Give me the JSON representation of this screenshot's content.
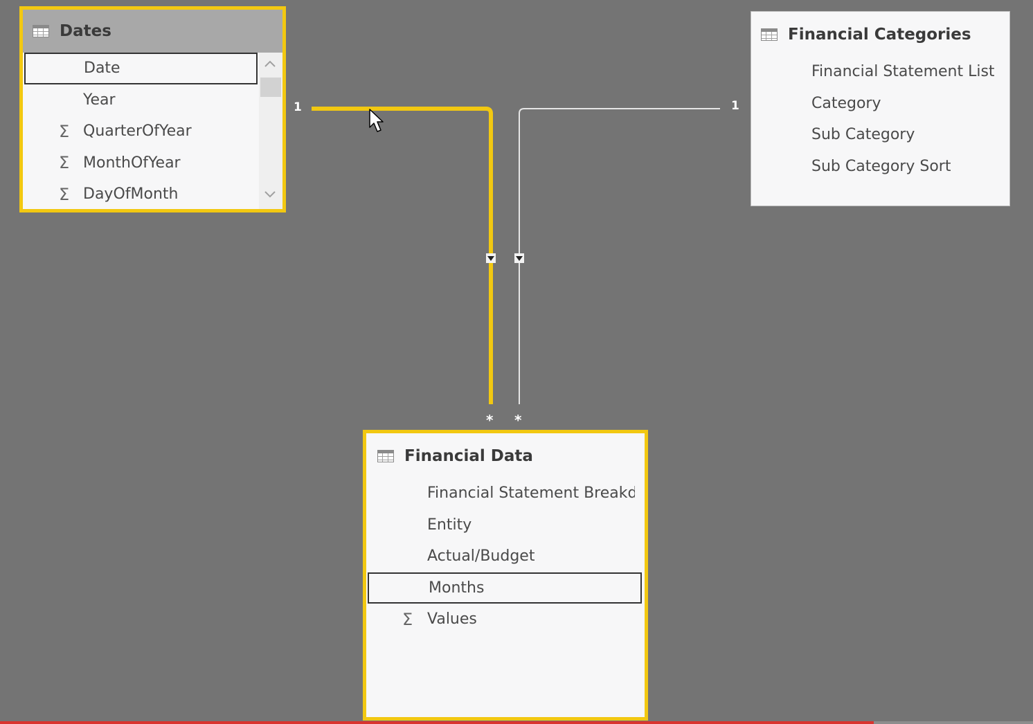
{
  "colors": {
    "canvas_bg": "#747474",
    "selected_accent": "#f2c811",
    "relationship_inactive": "#e6e6e6",
    "progress_fill": "#d9342f"
  },
  "tables": {
    "dates": {
      "title": "Dates",
      "icon": "table-icon",
      "selected": true,
      "fields": [
        {
          "label": "Date",
          "aggregate": false,
          "highlighted": true
        },
        {
          "label": "Year",
          "aggregate": false,
          "highlighted": false
        },
        {
          "label": "QuarterOfYear",
          "aggregate": true,
          "highlighted": false
        },
        {
          "label": "MonthOfYear",
          "aggregate": true,
          "highlighted": false
        },
        {
          "label": "DayOfMonth",
          "aggregate": true,
          "highlighted": false
        }
      ],
      "scroll_up_glyph": "⌃",
      "scroll_down_glyph": "⌄"
    },
    "financial_categories": {
      "title": "Financial Categories",
      "icon": "table-icon",
      "selected": false,
      "fields": [
        {
          "label": "Financial Statement List"
        },
        {
          "label": "Category"
        },
        {
          "label": "Sub Category"
        },
        {
          "label": "Sub Category Sort"
        }
      ]
    },
    "financial_data": {
      "title": "Financial Data",
      "icon": "table-icon",
      "selected": true,
      "fields": [
        {
          "label": "Financial Statement Breakd",
          "aggregate": false,
          "highlighted": false
        },
        {
          "label": "Entity",
          "aggregate": false,
          "highlighted": false
        },
        {
          "label": "Actual/Budget",
          "aggregate": false,
          "highlighted": false
        },
        {
          "label": "Months",
          "aggregate": false,
          "highlighted": true
        },
        {
          "label": "Values",
          "aggregate": true,
          "highlighted": false
        }
      ]
    }
  },
  "relationships": [
    {
      "from": "Dates",
      "to": "Financial Data",
      "from_cardinality": "1",
      "to_cardinality": "*",
      "active_selected": true,
      "direction": "single"
    },
    {
      "from": "Financial Categories",
      "to": "Financial Data",
      "from_cardinality": "1",
      "to_cardinality": "*",
      "active_selected": false,
      "direction": "single"
    }
  ],
  "sigma_glyph": "Σ",
  "video_progress": 0.846
}
